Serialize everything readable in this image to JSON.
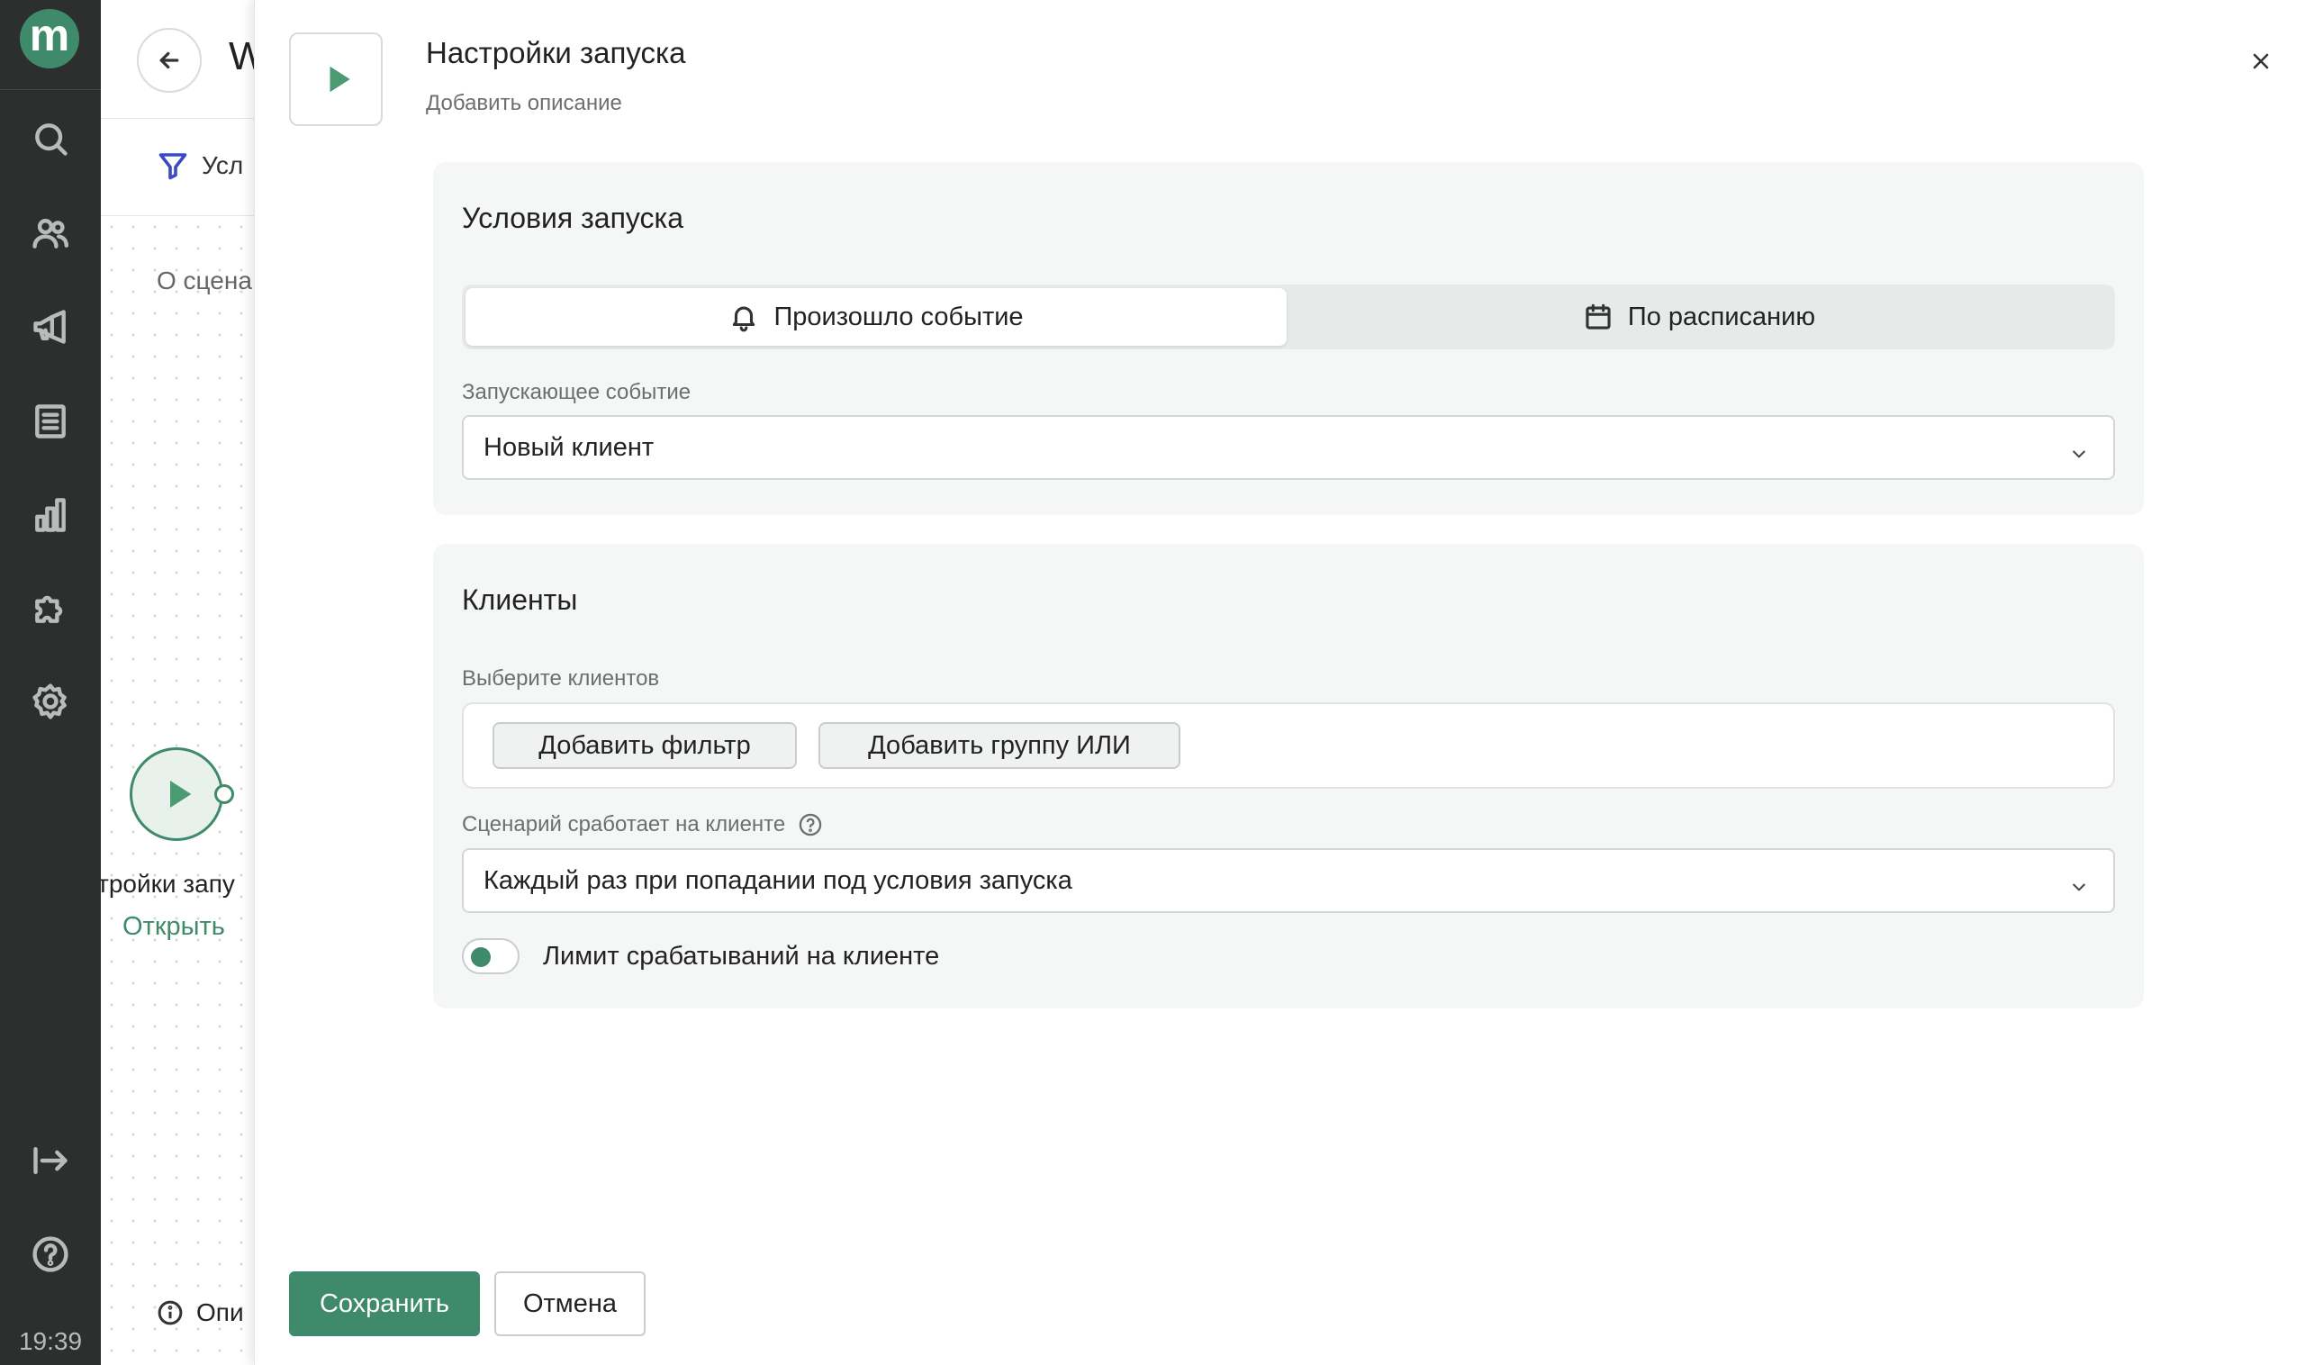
{
  "sidebar": {
    "logo_text": "m",
    "nav_icons": [
      "search-icon",
      "users-icon",
      "megaphone-icon",
      "document-icon",
      "chart-icon",
      "puzzle-icon",
      "gear-icon"
    ],
    "bottom_icons": [
      "collapse-icon",
      "help-icon"
    ],
    "clock": "19:39"
  },
  "background_page": {
    "title": "W",
    "filter_label": "Усл",
    "about_label": "О сцена",
    "node_label": "тройки запу",
    "node_open": "Открыть",
    "desc_label": "Опи"
  },
  "drawer": {
    "title": "Настройки запуска",
    "subtitle": "Добавить описание",
    "trigger_card": {
      "title": "Условия запуска",
      "tabs": [
        {
          "label": "Произошло событие",
          "icon": "bell-icon",
          "active": true
        },
        {
          "label": "По расписанию",
          "icon": "calendar-icon",
          "active": false
        }
      ],
      "event_label": "Запускающее событие",
      "event_value": "Новый клиент"
    },
    "clients_card": {
      "title": "Клиенты",
      "select_label": "Выберите клиентов",
      "add_filter": "Добавить фильтр",
      "add_or_group": "Добавить группу ИЛИ",
      "trigger_mode_label": "Сценарий сработает на клиенте",
      "trigger_mode_value": "Каждый раз при попадании под условия запуска",
      "limit_label": "Лимит срабатываний на клиенте"
    },
    "save_label": "Сохранить",
    "cancel_label": "Отмена"
  },
  "colors": {
    "brand": "#3f8a6b",
    "sidebar_bg": "#2c2f2e",
    "card_bg": "#f5f7f6"
  }
}
